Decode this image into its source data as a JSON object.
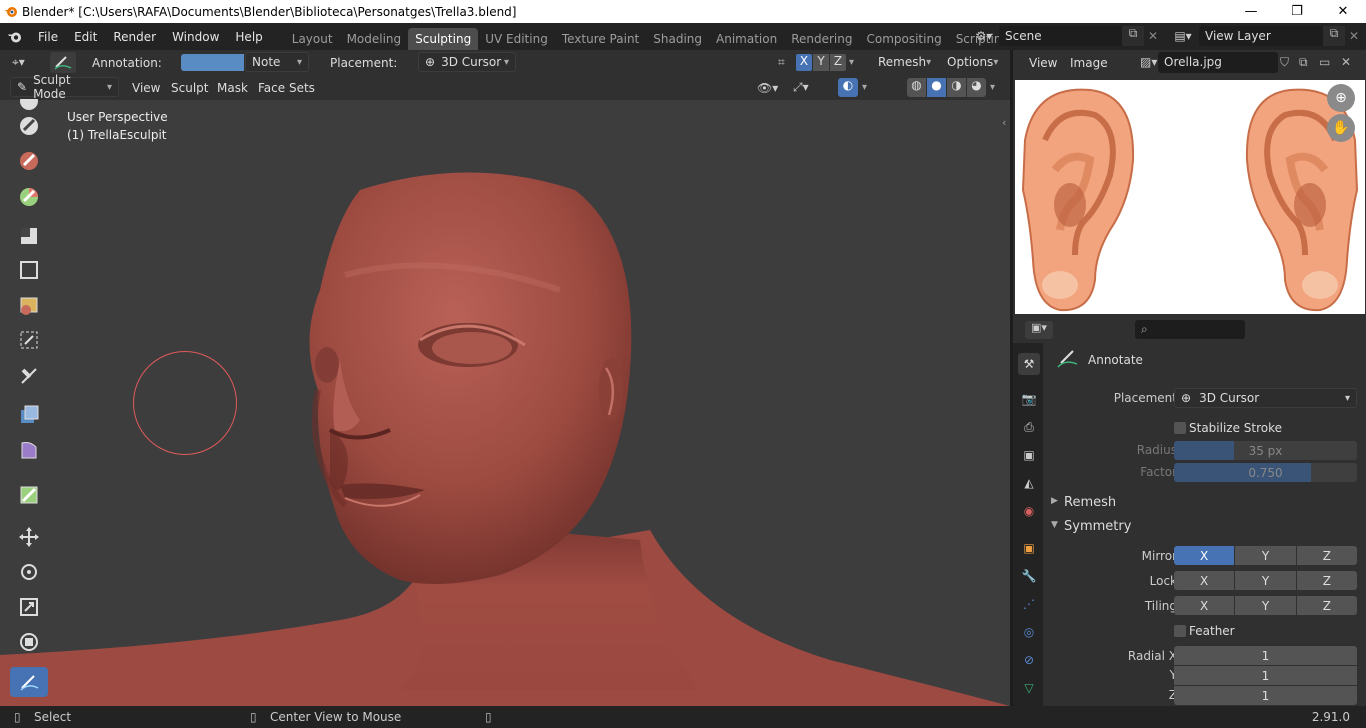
{
  "titlebar": {
    "title": "Blender* [C:\\Users\\RAFA\\Documents\\Blender\\Biblioteca\\Personatges\\Trella3.blend]",
    "minimize": "—",
    "maximize": "❐",
    "close": "✕"
  },
  "menu": {
    "items": [
      "File",
      "Edit",
      "Render",
      "Window",
      "Help"
    ]
  },
  "workspaces": {
    "tabs": [
      "Layout",
      "Modeling",
      "Sculpting",
      "UV Editing",
      "Texture Paint",
      "Shading",
      "Animation",
      "Rendering",
      "Compositing",
      "Scripting"
    ],
    "active": "Sculpting",
    "add": "+"
  },
  "scene": {
    "label": "Scene"
  },
  "view_layer": {
    "label": "View Layer"
  },
  "tool_header": {
    "annotation_label": "Annotation:",
    "note_label": "Note",
    "placement_label": "Placement:",
    "placement_value": "3D Cursor",
    "axis_x": "X",
    "axis_y": "Y",
    "axis_z": "Z",
    "remesh": "Remesh",
    "options": "Options"
  },
  "viewport_header": {
    "mode": "Sculpt Mode",
    "menus": [
      "View",
      "Sculpt",
      "Mask",
      "Face Sets"
    ]
  },
  "viewport": {
    "perspective": "User Perspective",
    "object": "(1) TrellaEsculpit"
  },
  "image_editor": {
    "view": "View",
    "image": "Image",
    "filename": "Orella.jpg"
  },
  "properties": {
    "tool_name": "Annotate",
    "placement_label": "Placement",
    "placement_value": "3D Cursor",
    "stabilize_label": "Stabilize Stroke",
    "radius_label": "Radius",
    "radius_value": "35 px",
    "radius_fraction": 0.33,
    "factor_label": "Factor",
    "factor_value": "0.750",
    "factor_fraction": 0.75,
    "remesh_panel": "Remesh",
    "symmetry_panel": "Symmetry",
    "mirror_label": "Mirror",
    "lock_label": "Lock",
    "tiling_label": "Tiling",
    "axes": [
      "X",
      "Y",
      "Z"
    ],
    "feather_label": "Feather",
    "radial_x_label": "Radial X",
    "radial_y_label": "Y",
    "radial_z_label": "Z",
    "radial_x": "1",
    "radial_y": "1",
    "radial_z": "1"
  },
  "status": {
    "select": "Select",
    "center": "Center View to Mouse",
    "version": "2.91.0"
  },
  "colors": {
    "accent": "#4772b3",
    "skin": "#a14f45",
    "viewport_bg": "#3d3d3d",
    "brush_circle": "#e05a5a"
  }
}
